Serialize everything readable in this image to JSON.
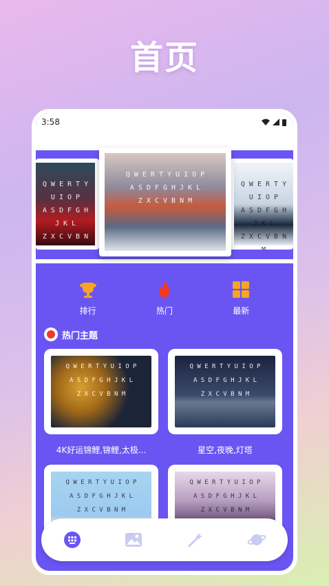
{
  "promo": {
    "title": "首页"
  },
  "status": {
    "time": "3:58"
  },
  "carousel": {
    "keyboard_rows": [
      "Q W E R T Y U I O P",
      "A S D F G H J K L",
      "Z X C V B N M"
    ]
  },
  "categories": [
    {
      "label": "排行",
      "icon": "trophy-icon"
    },
    {
      "label": "热门",
      "icon": "flame-icon"
    },
    {
      "label": "最新",
      "icon": "grid-icon"
    }
  ],
  "section": {
    "title": "热门主题"
  },
  "themes": [
    {
      "name": "4K好运锦鲤,锦鲤,太极..."
    },
    {
      "name": "星空,夜晚,灯塔"
    },
    {
      "name": ""
    },
    {
      "name": ""
    }
  ],
  "tabbar": {
    "tabs": [
      "keyboard-icon",
      "image-icon",
      "magic-wand-icon",
      "planet-icon"
    ]
  },
  "colors": {
    "primary": "#6a55f2",
    "accent": "#ef3a2a",
    "icon_orange": "#f7a428"
  }
}
